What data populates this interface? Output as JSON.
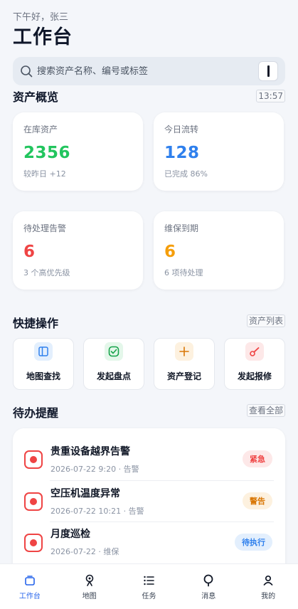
{
  "header": {
    "greeting": "下午好，张三",
    "title": "工作台"
  },
  "search": {
    "placeholder": "搜索资产名称、编号或标签"
  },
  "overview": {
    "title": "资产概览",
    "time": "13:57",
    "cards": [
      {
        "label": "在库资产",
        "value": "2356",
        "sub": "较昨日 +12",
        "color": "#22c55e"
      },
      {
        "label": "今日流转",
        "value": "128",
        "sub": "已完成 86%",
        "color": "#2f80ed"
      },
      {
        "label": "待处理告警",
        "value": "6",
        "sub": "3 个高优先级",
        "color": "#ef4444"
      },
      {
        "label": "维保到期",
        "value": "6",
        "sub": "6 项待处理",
        "color": "#f59e0b"
      }
    ]
  },
  "quick": {
    "title": "快捷操作",
    "link": "资产列表",
    "actions": [
      {
        "label": "地图查找",
        "icon": "map-icon"
      },
      {
        "label": "发起盘点",
        "icon": "checklist-icon"
      },
      {
        "label": "资产登记",
        "icon": "plus-icon"
      },
      {
        "label": "发起报修",
        "icon": "wrench-icon"
      }
    ]
  },
  "todo": {
    "title": "待办提醒",
    "link": "查看全部",
    "items": [
      {
        "title": "贵重设备越界告警",
        "meta": "2026-07-22 9:20 · 告警",
        "badge": "紧急"
      },
      {
        "title": "空压机温度异常",
        "meta": "2026-07-22 10:21 · 告警",
        "badge": "警告"
      },
      {
        "title": "月度巡检",
        "meta": "2026-07-22 · 维保",
        "badge": "待执行"
      }
    ]
  },
  "tabs": [
    {
      "label": "工作台",
      "icon": "home-icon",
      "active": true
    },
    {
      "label": "地图",
      "icon": "location-pin-icon"
    },
    {
      "label": "任务",
      "icon": "list-icon"
    },
    {
      "label": "消息",
      "icon": "message-icon"
    },
    {
      "label": "我的",
      "icon": "user-icon"
    }
  ]
}
